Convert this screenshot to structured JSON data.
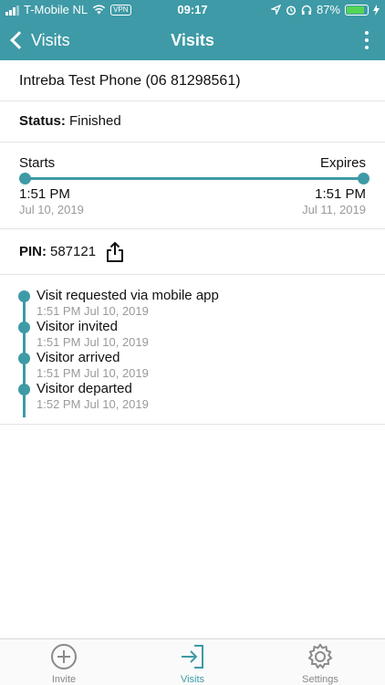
{
  "status_bar": {
    "carrier": "T-Mobile NL",
    "vpn": "VPN",
    "time": "09:17",
    "battery": "87%",
    "battery_level": 0.87
  },
  "nav": {
    "back_label": "Visits",
    "title": "Visits"
  },
  "visit": {
    "host": "Intreba Test Phone (06 81298561)",
    "status_label": "Status:",
    "status_value": "Finished",
    "starts_label": "Starts",
    "expires_label": "Expires",
    "start_time": "1:51 PM",
    "start_date": "Jul 10, 2019",
    "end_time": "1:51 PM",
    "end_date": "Jul 11, 2019",
    "pin_label": "PIN:",
    "pin_value": "587121"
  },
  "timeline": [
    {
      "event": "Visit requested via mobile app",
      "time": "1:51 PM Jul 10, 2019"
    },
    {
      "event": "Visitor invited",
      "time": "1:51 PM Jul 10, 2019"
    },
    {
      "event": "Visitor arrived",
      "time": "1:51 PM Jul 10, 2019"
    },
    {
      "event": "Visitor departed",
      "time": "1:52 PM Jul 10, 2019"
    }
  ],
  "tabs": [
    {
      "label": "Invite",
      "icon": "plus-circle-icon"
    },
    {
      "label": "Visits",
      "icon": "sign-in-icon"
    },
    {
      "label": "Settings",
      "icon": "gear-icon"
    }
  ],
  "colors": {
    "accent": "#3e9aa6",
    "muted_text": "#9a9a9a",
    "battery_fill": "#55d456"
  }
}
